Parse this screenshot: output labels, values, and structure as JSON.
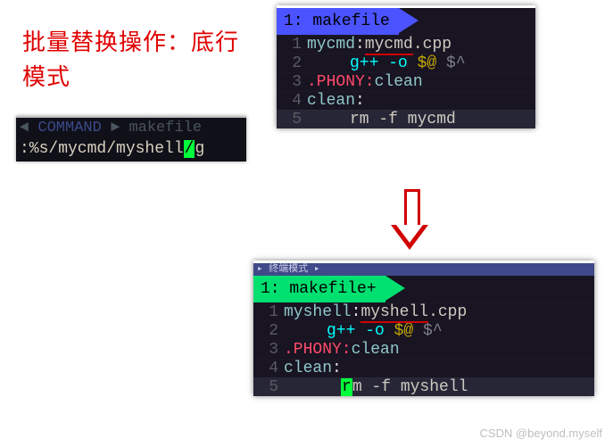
{
  "caption": {
    "line1": "批量替换操作：底行",
    "line2": "模式"
  },
  "status": {
    "mode": "COMMAND",
    "file": "makefile",
    "cmd_prefix": ":%s/mycmd/myshell",
    "cmd_cursor": "/",
    "cmd_suffix": "g"
  },
  "box_top": {
    "tab_index": "1:",
    "tab_name": "makefile",
    "lines": [
      {
        "n": "1",
        "target": "mycmd",
        "colon": ":",
        "dep_u": "mycmd",
        "dep_rest": ".cpp"
      },
      {
        "n": "2",
        "cmd": "g++ -o ",
        "a1": "$@",
        "sp": " ",
        "a2": "$^"
      },
      {
        "n": "3",
        "phony": ".PHONY:",
        "label": "clean"
      },
      {
        "n": "4",
        "target": "clean",
        "colon": ":"
      },
      {
        "n": "5",
        "rm": "rm -f mycmd"
      }
    ]
  },
  "box_bot": {
    "tab_strip": "▸ 终端模式 ▸",
    "tab_index": "1:",
    "tab_name": "makefile+",
    "lines": [
      {
        "n": "1",
        "target": "myshell",
        "colon": ":",
        "dep_u": "myshell",
        "dep_rest": ".cpp"
      },
      {
        "n": "2",
        "cmd": "g++ -o ",
        "a1": "$@",
        "sp": " ",
        "a2": "$^"
      },
      {
        "n": "3",
        "phony": ".PHONY:",
        "label": "clean"
      },
      {
        "n": "4",
        "target": "clean",
        "colon": ":"
      },
      {
        "n": "5",
        "cur": "r",
        "rm_rest": "m -f myshell"
      }
    ]
  },
  "watermark": "CSDN @beyond.myself"
}
